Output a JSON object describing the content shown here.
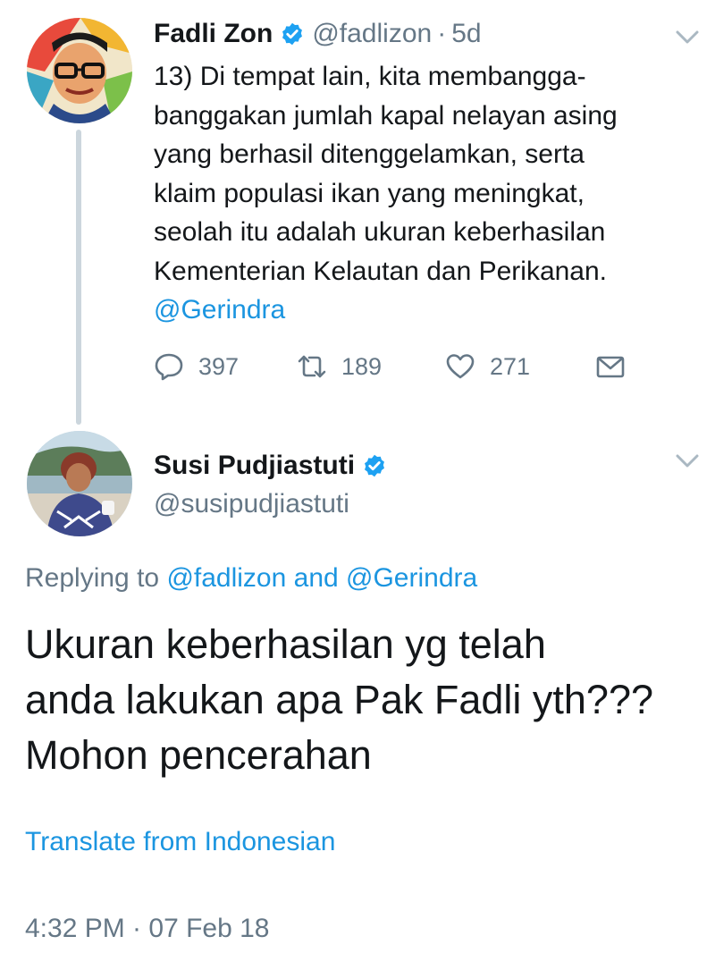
{
  "tweet_original": {
    "author_name": "Fadli Zon",
    "handle": "@fadlizon",
    "separator": "·",
    "age": "5d",
    "text_lines": [
      "13) Di tempat lain, kita membangga-",
      "banggakan jumlah kapal nelayan asing",
      "yang berhasil ditenggelamkan, serta",
      "klaim populasi ikan yang meningkat,",
      "seolah itu adalah ukuran keberhasilan",
      "Kementerian Kelautan dan Perikanan."
    ],
    "mention": "@Gerindra",
    "replies": "397",
    "retweets": "189",
    "likes": "271",
    "icons": [
      "verified-badge-icon",
      "chevron-down-icon",
      "reply-icon",
      "retweet-icon",
      "like-icon",
      "direct-message-icon"
    ]
  },
  "tweet_reply": {
    "author_name": "Susi Pudjiastuti",
    "handle": "@susipudjiastuti",
    "replying_prefix": "Replying to ",
    "replying_to": "@fadlizon and @Gerindra",
    "text_lines": [
      "Ukuran keberhasilan yg telah",
      "anda lakukan apa Pak Fadli yth???",
      "Mohon pencerahan"
    ],
    "translate_label": "Translate from Indonesian",
    "timestamp": "4:32 PM · 07 Feb 18"
  },
  "colors": {
    "link": "#1b95e0",
    "muted": "#657786",
    "text": "#14171a",
    "verified": "#1da1f2",
    "thread_line": "#ccd6dd"
  }
}
